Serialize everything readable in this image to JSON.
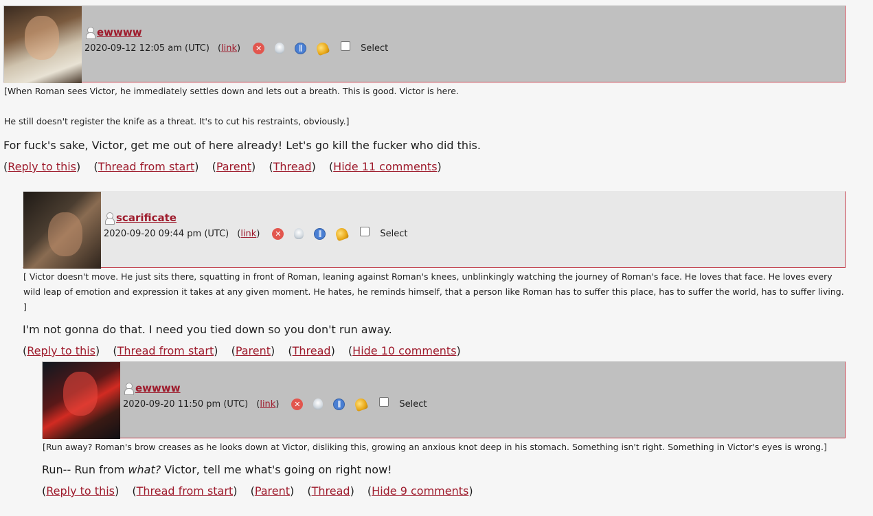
{
  "comments": [
    {
      "username": "ewwww",
      "date": "2020-09-12 12:05 am (UTC)",
      "link_label": "link",
      "select_label": "Select",
      "text_small": [
        "[When Roman sees Victor, he immediately settles down and lets out a breath. This is good. Victor is here.",
        "He still doesn't register the knife as a threat. It's to cut his restraints, obviously.]"
      ],
      "text_main": "For fuck's sake, Victor, get me out of here already! Let's go kill the fucker who did this.",
      "links": [
        "Reply to this",
        "Thread from start",
        "Parent",
        "Thread",
        "Hide 11 comments"
      ]
    },
    {
      "username": "scarificate",
      "date": "2020-09-20 09:44 pm (UTC)",
      "link_label": "link",
      "select_label": "Select",
      "text_small": [
        "[ Victor doesn't move. He just sits there, squatting in front of Roman, leaning against Roman's knees, unblinkingly watching the journey of Roman's face. He loves that face. He loves every wild leap of emotion and expression it takes at any given moment. He hates, he reminds himself, that a person like Roman has to suffer this place, has to suffer the world, has to suffer living. ]"
      ],
      "text_main": "I'm not gonna do that. I need you tied down so you don't run away.",
      "links": [
        "Reply to this",
        "Thread from start",
        "Parent",
        "Thread",
        "Hide 10 comments"
      ]
    },
    {
      "username": "ewwww",
      "date": "2020-09-20 11:50 pm (UTC)",
      "link_label": "link",
      "select_label": "Select",
      "text_small": [
        "[Run away? Roman's brow creases as he looks down at Victor, disliking this, growing an anxious knot deep in his stomach. Something isn't right. Something in Victor's eyes is wrong.]"
      ],
      "text_main_pre": "Run-- Run from ",
      "text_main_em": "what?",
      "text_main_post": " Victor, tell me what's going on right now!",
      "links": [
        "Reply to this",
        "Thread from start",
        "Parent",
        "Thread",
        "Hide 9 comments"
      ]
    }
  ],
  "icons": [
    "user-icon",
    "delete-icon",
    "track-icon",
    "freeze-icon",
    "screen-icon"
  ],
  "colors": {
    "link": "#9e1b2c",
    "header_dark": "#c0c0c0",
    "header_light": "#e8e8e8",
    "border": "#c13d4a"
  }
}
